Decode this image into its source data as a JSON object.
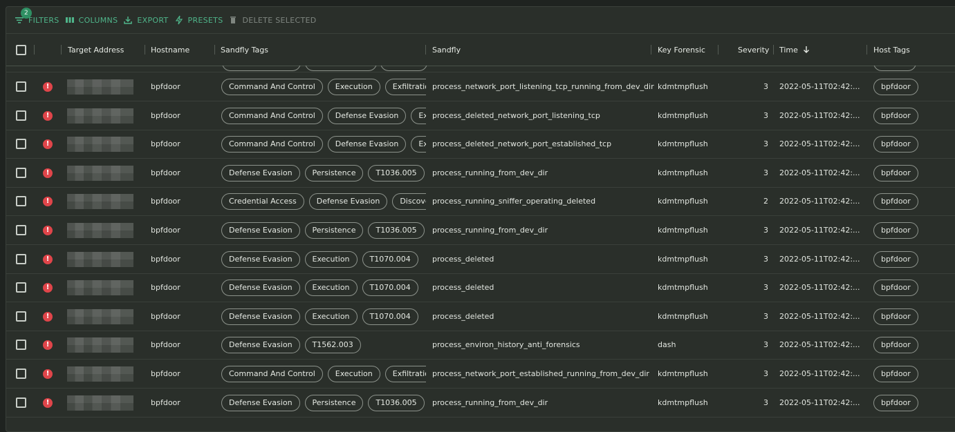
{
  "toolbar": {
    "filter_count": "2",
    "filters_label": "FILTERS",
    "columns_label": "COLUMNS",
    "export_label": "EXPORT",
    "presets_label": "PRESETS",
    "delete_label": "DELETE SELECTED"
  },
  "columns": {
    "target_address": "Target Address",
    "hostname": "Hostname",
    "sandfly_tags": "Sandfly Tags",
    "sandfly": "Sandfly",
    "key_forensic": "Key Forensic",
    "severity": "Severity",
    "time": "Time",
    "host_tags": "Host Tags"
  },
  "colors": {
    "accent": "#4fb58a",
    "alert": "#e0454a",
    "panel": "#2a2f2a"
  },
  "rows": [
    {
      "hostname": "bpfdoor",
      "tags": [
        "Command And Control",
        "Execution",
        "Exfiltration"
      ],
      "sandfly": "process_network_port_listening_tcp_running_from_dev_dir",
      "key_forensic": "kdmtmpflush",
      "severity": "3",
      "time": "2022-05-11T02:42:...",
      "host_tag": "bpfdoor"
    },
    {
      "hostname": "bpfdoor",
      "tags": [
        "Command And Control",
        "Defense Evasion",
        "Execution"
      ],
      "sandfly": "process_deleted_network_port_listening_tcp",
      "key_forensic": "kdmtmpflush",
      "severity": "3",
      "time": "2022-05-11T02:42:...",
      "host_tag": "bpfdoor"
    },
    {
      "hostname": "bpfdoor",
      "tags": [
        "Command And Control",
        "Defense Evasion",
        "Execution"
      ],
      "sandfly": "process_deleted_network_port_established_tcp",
      "key_forensic": "kdmtmpflush",
      "severity": "3",
      "time": "2022-05-11T02:42:...",
      "host_tag": "bpfdoor"
    },
    {
      "hostname": "bpfdoor",
      "tags": [
        "Defense Evasion",
        "Persistence",
        "T1036.005"
      ],
      "sandfly": "process_running_from_dev_dir",
      "key_forensic": "kdmtmpflush",
      "severity": "3",
      "time": "2022-05-11T02:42:...",
      "host_tag": "bpfdoor"
    },
    {
      "hostname": "bpfdoor",
      "tags": [
        "Credential Access",
        "Defense Evasion",
        "Discovery"
      ],
      "sandfly": "process_running_sniffer_operating_deleted",
      "key_forensic": "kdmtmpflush",
      "severity": "2",
      "time": "2022-05-11T02:42:...",
      "host_tag": "bpfdoor"
    },
    {
      "hostname": "bpfdoor",
      "tags": [
        "Defense Evasion",
        "Persistence",
        "T1036.005"
      ],
      "sandfly": "process_running_from_dev_dir",
      "key_forensic": "kdmtmpflush",
      "severity": "3",
      "time": "2022-05-11T02:42:...",
      "host_tag": "bpfdoor"
    },
    {
      "hostname": "bpfdoor",
      "tags": [
        "Defense Evasion",
        "Execution",
        "T1070.004"
      ],
      "sandfly": "process_deleted",
      "key_forensic": "kdmtmpflush",
      "severity": "3",
      "time": "2022-05-11T02:42:...",
      "host_tag": "bpfdoor"
    },
    {
      "hostname": "bpfdoor",
      "tags": [
        "Defense Evasion",
        "Execution",
        "T1070.004"
      ],
      "sandfly": "process_deleted",
      "key_forensic": "kdmtmpflush",
      "severity": "3",
      "time": "2022-05-11T02:42:...",
      "host_tag": "bpfdoor"
    },
    {
      "hostname": "bpfdoor",
      "tags": [
        "Defense Evasion",
        "Execution",
        "T1070.004"
      ],
      "sandfly": "process_deleted",
      "key_forensic": "kdmtmpflush",
      "severity": "3",
      "time": "2022-05-11T02:42:...",
      "host_tag": "bpfdoor"
    },
    {
      "hostname": "bpfdoor",
      "tags": [
        "Defense Evasion",
        "T1562.003"
      ],
      "sandfly": "process_environ_history_anti_forensics",
      "key_forensic": "dash",
      "severity": "3",
      "time": "2022-05-11T02:42:...",
      "host_tag": "bpfdoor"
    },
    {
      "hostname": "bpfdoor",
      "tags": [
        "Command And Control",
        "Execution",
        "Exfiltration"
      ],
      "sandfly": "process_network_port_established_running_from_dev_dir",
      "key_forensic": "kdmtmpflush",
      "severity": "3",
      "time": "2022-05-11T02:42:...",
      "host_tag": "bpfdoor"
    },
    {
      "hostname": "bpfdoor",
      "tags": [
        "Defense Evasion",
        "Persistence",
        "T1036.005"
      ],
      "sandfly": "process_running_from_dev_dir",
      "key_forensic": "kdmtmpflush",
      "severity": "3",
      "time": "2022-05-11T02:42:...",
      "host_tag": "bpfdoor"
    }
  ]
}
